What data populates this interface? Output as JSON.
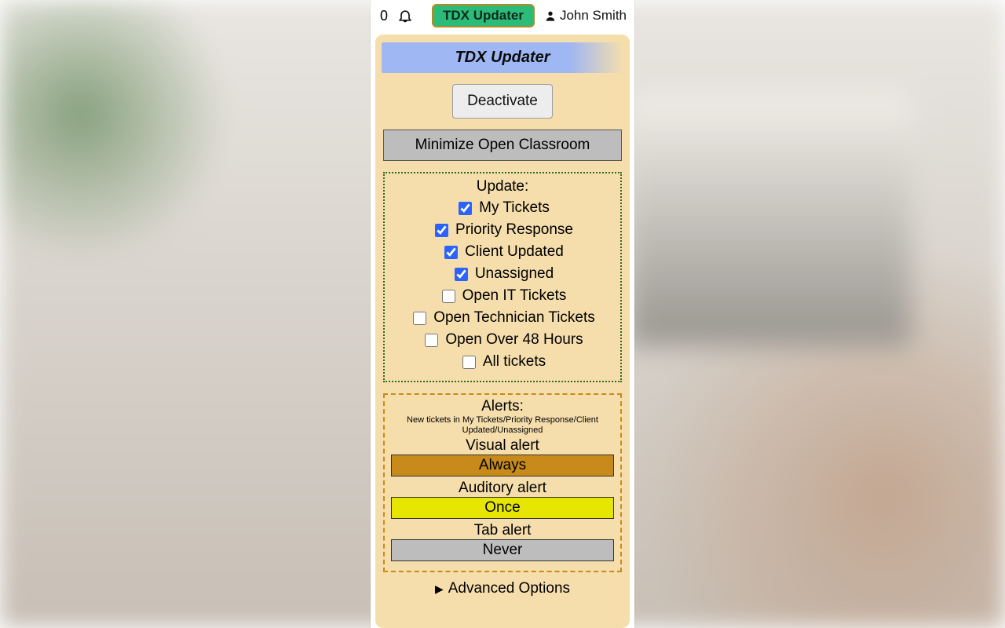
{
  "topbar": {
    "count": "0",
    "tdx_label": "TDX Updater",
    "user_name": "John Smith"
  },
  "panel": {
    "title": "TDX Updater",
    "deactivate_label": "Deactivate",
    "minimize_label": "Minimize Open Classroom"
  },
  "update": {
    "header": "Update:",
    "items": [
      {
        "label": "My Tickets",
        "checked": true
      },
      {
        "label": "Priority Response",
        "checked": true
      },
      {
        "label": "Client Updated",
        "checked": true
      },
      {
        "label": "Unassigned",
        "checked": true
      },
      {
        "label": "Open IT Tickets",
        "checked": false
      },
      {
        "label": "Open Technician Tickets",
        "checked": false
      },
      {
        "label": "Open Over 48 Hours",
        "checked": false
      },
      {
        "label": "All tickets",
        "checked": false
      }
    ]
  },
  "alerts": {
    "header": "Alerts:",
    "subtitle": "New tickets in My Tickets/Priority Response/Client Updated/Unassigned",
    "visual_label": "Visual alert",
    "visual_value": "Always",
    "auditory_label": "Auditory alert",
    "auditory_value": "Once",
    "tab_label": "Tab alert",
    "tab_value": "Never"
  },
  "advanced_label": "Advanced Options"
}
